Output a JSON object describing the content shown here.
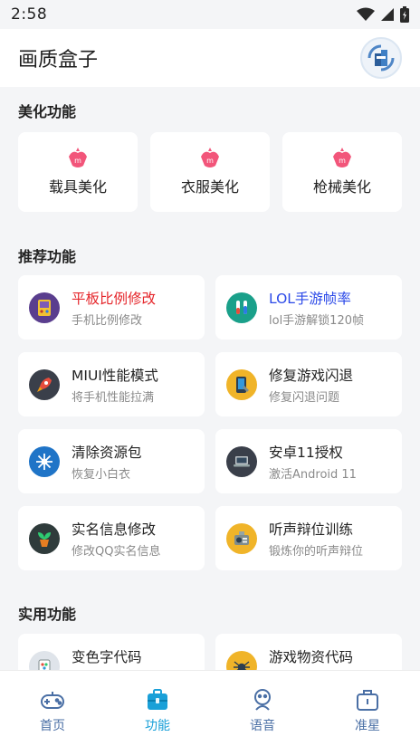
{
  "status": {
    "time": "2:58"
  },
  "app": {
    "title": "画质盒子"
  },
  "sections": {
    "beauty": {
      "title": "美化功能",
      "items": [
        {
          "label": "载具美化"
        },
        {
          "label": "衣服美化"
        },
        {
          "label": "枪械美化"
        }
      ]
    },
    "recommend": {
      "title": "推荐功能",
      "items": [
        {
          "title": "平板比例修改",
          "subtitle": "手机比例修改",
          "icon": "gamepad-icon"
        },
        {
          "title": "LOL手游帧率",
          "subtitle": "lol手游解锁120帧",
          "icon": "lab-tubes-icon"
        },
        {
          "title": "MIUI性能模式",
          "subtitle": "将手机性能拉满",
          "icon": "rocket-icon"
        },
        {
          "title": "修复游戏闪退",
          "subtitle": "修复闪退问题",
          "icon": "phone-repair-icon"
        },
        {
          "title": "清除资源包",
          "subtitle": "恢复小白衣",
          "icon": "snowflake-icon"
        },
        {
          "title": "安卓11授权",
          "subtitle": "激活Android 11",
          "icon": "laptop-icon"
        },
        {
          "title": "实名信息修改",
          "subtitle": "修改QQ实名信息",
          "icon": "plant-pot-icon"
        },
        {
          "title": "听声辩位训练",
          "subtitle": "锻炼你的听声辩位",
          "icon": "radio-icon"
        }
      ]
    },
    "utility": {
      "title": "实用功能",
      "items": [
        {
          "title": "变色字代码",
          "icon": "palette-icon"
        },
        {
          "title": "游戏物资代码",
          "icon": "spider-icon"
        }
      ]
    }
  },
  "nav": [
    {
      "label": "首页",
      "icon": "gamepad-nav-icon",
      "active": false
    },
    {
      "label": "功能",
      "icon": "toolbox-icon",
      "active": true
    },
    {
      "label": "语音",
      "icon": "voice-user-icon",
      "active": false
    },
    {
      "label": "准星",
      "icon": "briefcase-icon",
      "active": false
    }
  ],
  "colors": {
    "accent": "#2b49e8",
    "alert": "#e5262b",
    "nav": "#4a6fa5",
    "nav_active": "#1aa0d8"
  }
}
